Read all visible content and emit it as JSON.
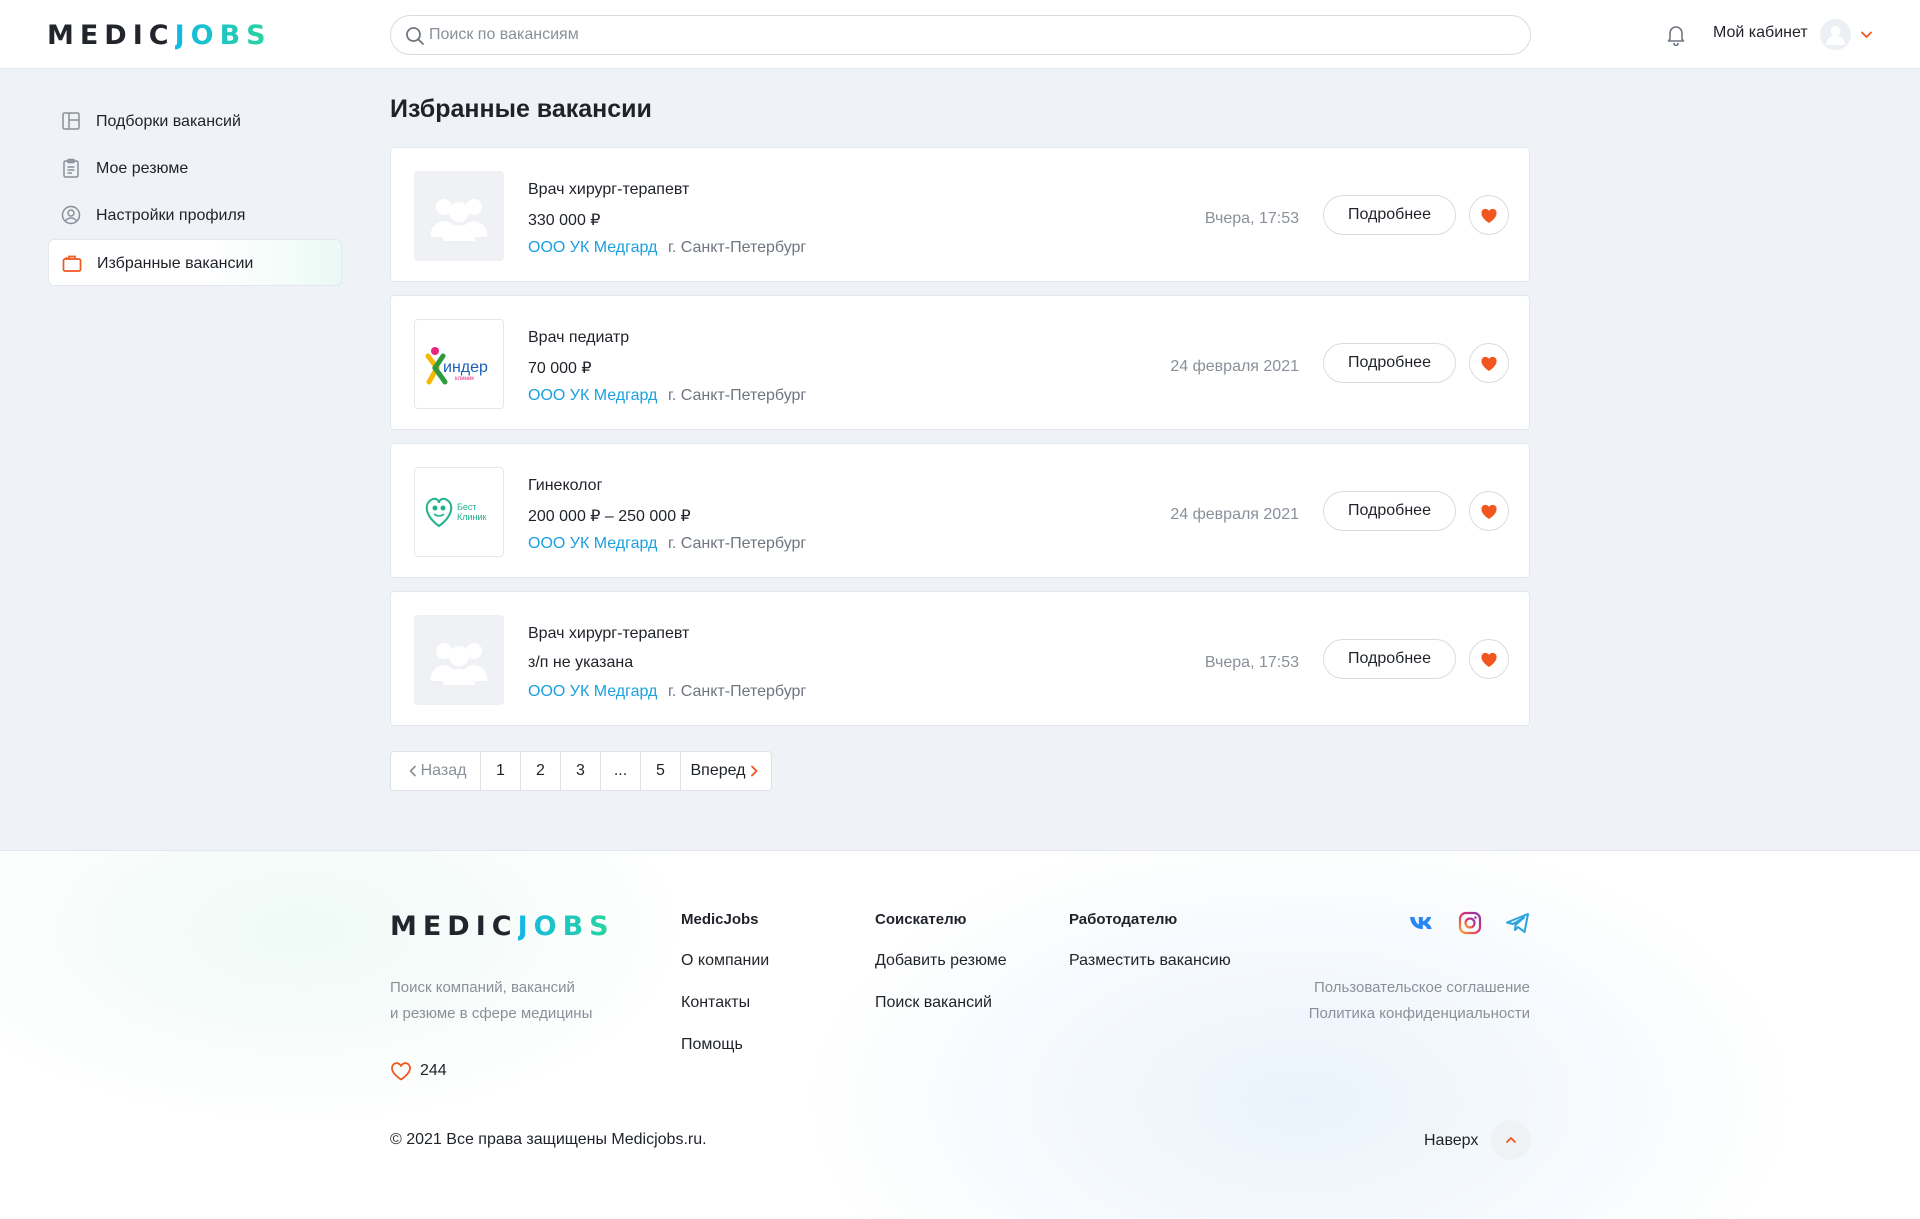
{
  "brand": {
    "part1": "MEDIC",
    "part2": "JOBS"
  },
  "header": {
    "search_placeholder": "Поиск по вакансиям",
    "cabinet_label": "Мой кабинет"
  },
  "sidebar": {
    "items": [
      {
        "label": "Подборки вакансий",
        "icon": "layout-icon",
        "active": false
      },
      {
        "label": "Мое резюме",
        "icon": "clipboard-icon",
        "active": false
      },
      {
        "label": "Настройки профиля",
        "icon": "user-circle-icon",
        "active": false
      },
      {
        "label": "Избранные вакансии",
        "icon": "briefcase-icon",
        "active": true
      }
    ]
  },
  "main": {
    "title": "Избранные вакансии",
    "more_label": "Подробнее",
    "vacancies": [
      {
        "title": "Врач хирург-терапевт",
        "salary": "330 000 ₽",
        "company": "ООО УК Медгард",
        "city": "г. Санкт-Петербург",
        "date": "Вчера, 17:53",
        "logo": "placeholder"
      },
      {
        "title": "Врач педиатр",
        "salary": "70 000 ₽",
        "company": "ООО УК Медгард",
        "city": "г. Санкт-Петербург",
        "date": "24 февраля 2021",
        "logo": "kinder-klinik",
        "logo_text_1": "индер",
        "logo_text_2": "клиник"
      },
      {
        "title": "Гинеколог",
        "salary": "200 000 ₽ – 250 000 ₽",
        "company": "ООО УК Медгард",
        "city": "г. Санкт-Петербург",
        "date": "24 февраля 2021",
        "logo": "best-klinik",
        "logo_text_1": "Бест",
        "logo_text_2": "Клиник"
      },
      {
        "title": "Врач хирург-терапевт",
        "salary": "з/п не указана",
        "company": "ООО УК Медгард",
        "city": "г. Санкт-Петербург",
        "date": "Вчера, 17:53",
        "logo": "placeholder"
      }
    ]
  },
  "pagination": {
    "back": "Назад",
    "pages": [
      "1",
      "2",
      "3",
      "...",
      "5"
    ],
    "next": "Вперед"
  },
  "footer": {
    "description_1": "Поиск компаний, вакансий",
    "description_2": "и резюме в сфере медицины",
    "likes": "244",
    "columns": [
      {
        "heading": "MedicJobs",
        "links": [
          "О компании",
          "Контакты",
          "Помощь"
        ]
      },
      {
        "heading": "Соискателю",
        "links": [
          "Добавить резюме",
          "Поиск вакансий"
        ]
      },
      {
        "heading": "Работодателю",
        "links": [
          "Разместить вакансию"
        ]
      }
    ],
    "socials": [
      "vk-icon",
      "instagram-icon",
      "telegram-icon"
    ],
    "legal": [
      "Пользовательское соглашение",
      "Политика конфиденциальности"
    ],
    "copyright": "© 2021 Все права защищены Medicjobs.ru.",
    "to_top": "Наверх"
  },
  "colors": {
    "accent": "#f0561e",
    "link": "#1a9fe0",
    "brand_gradient_start": "#12b8e6",
    "brand_gradient_end": "#2bd59a"
  }
}
